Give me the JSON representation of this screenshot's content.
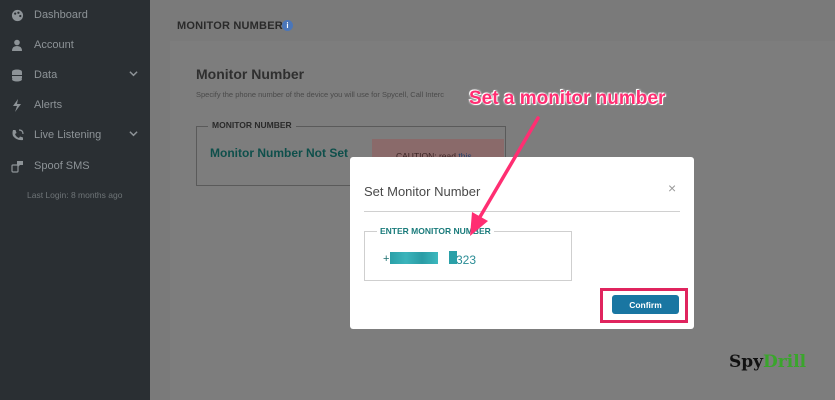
{
  "sidebar": {
    "items": [
      {
        "label": "Dashboard",
        "icon": "palette-icon"
      },
      {
        "label": "Account",
        "icon": "user-icon"
      },
      {
        "label": "Data",
        "icon": "database-icon",
        "has_chevron": true
      },
      {
        "label": "Alerts",
        "icon": "bolt-icon"
      },
      {
        "label": "Live Listening",
        "icon": "phone-volume-icon",
        "has_chevron": true
      },
      {
        "label": "Spoof SMS",
        "icon": "sms-icon"
      }
    ],
    "last_login": "Last Login: 8 months ago"
  },
  "page": {
    "header_title": "MONITOR NUMBER",
    "info_icon": "info-icon",
    "panel_title": "Monitor Number",
    "panel_description": "Specify the phone number of the device you will use for Spycell, Call Interc",
    "monitor_box_legend": "MONITOR NUMBER",
    "monitor_value": "Monitor Number Not Set",
    "caution_text": "CAUTION: read ",
    "caution_link": "this"
  },
  "modal": {
    "title": "Set Monitor Number",
    "close_symbol": "×",
    "input_legend": "ENTER MONITOR NUMBER",
    "input_prefix": "+",
    "input_suffix": "323",
    "confirm_label": "Confirm"
  },
  "annotation": {
    "text": "Set a monitor number",
    "color": "#ff2e72"
  },
  "watermark": {
    "part1": "Spy",
    "part2": "Drill",
    "color1": "#111111",
    "color2": "#3aa52c"
  },
  "colors": {
    "sidebar_bg": "#2a2f33",
    "accent_teal": "#1a7b7b",
    "confirm_bg": "#1976a2",
    "highlight": "#e0245e"
  }
}
